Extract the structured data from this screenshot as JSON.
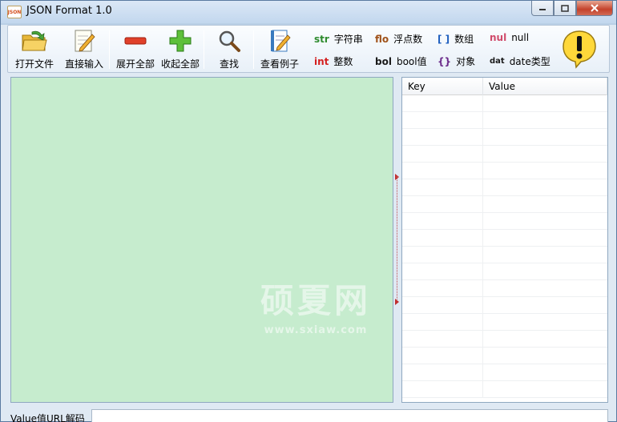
{
  "window": {
    "title": "JSON Format 1.0",
    "icon_text": "JSON"
  },
  "toolbar": {
    "open_file": "打开文件",
    "direct_input": "直接输入",
    "expand_all": "展开全部",
    "collapse_all": "收起全部",
    "find": "查找",
    "view_example": "查看例子"
  },
  "legend": [
    {
      "tag": "str",
      "label": "字符串",
      "color": "#2e8b2e"
    },
    {
      "tag": "int",
      "label": "整数",
      "color": "#d42020"
    },
    {
      "tag": "flo",
      "label": "浮点数",
      "color": "#a0521a"
    },
    {
      "tag": "bol",
      "label": "bool值",
      "color": "#1a1a1a"
    },
    {
      "tag": "[ ]",
      "label": "数组",
      "color": "#1f5fbf"
    },
    {
      "tag": "{}",
      "label": "对象",
      "color": "#6a2a8a"
    },
    {
      "tag": "nul",
      "label": "null",
      "color": "#d04a6a"
    },
    {
      "tag": "dat",
      "label": "date类型",
      "color": "#1a1a1a"
    }
  ],
  "table": {
    "columns": [
      "Key",
      "Value"
    ]
  },
  "watermark": {
    "main": "硕夏网",
    "sub": "www.sxiaw.com"
  },
  "bottom": {
    "label": "Value值URL解码",
    "input_value": ""
  },
  "colors": {
    "left_panel_bg": "#c6ecce",
    "accent_red": "#d42020"
  }
}
